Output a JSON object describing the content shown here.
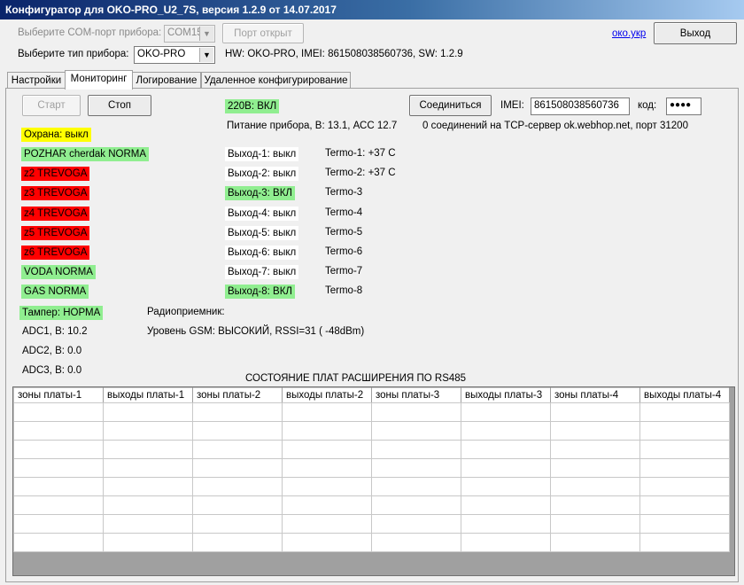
{
  "window": {
    "title": "Конфигуратор для OKO-PRO_U2_7S, версия 1.2.9 от 14.07.2017"
  },
  "top": {
    "com_label": "Выберите COM-порт прибора:",
    "com_value": "COM15",
    "port_button": "Порт открыт",
    "link": "око.укр",
    "exit_button": "Выход",
    "type_label": "Выберите тип прибора:",
    "type_value": "OKO-PRO",
    "hw_info": "HW: OKO-PRO, IMEI: 861508038560736, SW: 1.2.9"
  },
  "tabs": [
    "Настройки",
    "Мониторинг",
    "Логирование",
    "Удаленное конфигурирование"
  ],
  "monitor": {
    "start_button": "Старт",
    "stop_button": "Стоп",
    "power_status": "220В: ВКЛ",
    "power_info": "Питание прибора, В: 13.1, АСС 12.7",
    "connect_button": "Соединиться",
    "imei_label": "IMEI:",
    "imei_value": "861508038560736",
    "code_label": "код:",
    "code_value": "●●●●",
    "tcp_status": "0 соединений на TCP-сервер ok.webhop.net, порт 31200",
    "guard": "Охрана: выкл",
    "zones": [
      {
        "text": "POZHAR cherdak NORMA",
        "state": "green"
      },
      {
        "text": "z2 TREVOGA",
        "state": "red"
      },
      {
        "text": "z3 TREVOGA",
        "state": "red"
      },
      {
        "text": "z4 TREVOGA",
        "state": "red"
      },
      {
        "text": "z5 TREVOGA",
        "state": "red"
      },
      {
        "text": "z6 TREVOGA",
        "state": "red"
      },
      {
        "text": "VODA NORMA",
        "state": "green"
      },
      {
        "text": "GAS NORMA",
        "state": "green"
      }
    ],
    "outputs": [
      {
        "text": "Выход-1: выкл",
        "state": "white"
      },
      {
        "text": "Выход-2: выкл",
        "state": "white"
      },
      {
        "text": "Выход-3: ВКЛ",
        "state": "green"
      },
      {
        "text": "Выход-4: выкл",
        "state": "white"
      },
      {
        "text": "Выход-5: выкл",
        "state": "white"
      },
      {
        "text": "Выход-6: выкл",
        "state": "white"
      },
      {
        "text": "Выход-7: выкл",
        "state": "white"
      },
      {
        "text": "Выход-8: ВКЛ",
        "state": "green"
      }
    ],
    "thermo": [
      "Termo-1: +37 C",
      "Termo-2: +37 C",
      "Termo-3",
      "Termo-4",
      "Termo-5",
      "Termo-6",
      "Termo-7",
      "Termo-8"
    ],
    "tamper": "Тампер: НОРМА",
    "radio": "Радиоприемник:",
    "gsm": "Уровень GSM: ВЫСОКИЙ, RSSI=31 ( -48dBm)",
    "adc": [
      "ADC1, В: 10.2",
      "ADC2, В: 0.0",
      "ADC3, В: 0.0"
    ],
    "rs485_title": "СОСТОЯНИЕ ПЛАТ РАСШИРЕНИЯ ПО RS485",
    "grid_columns": [
      "зоны платы-1",
      "выходы платы-1",
      "зоны платы-2",
      "выходы платы-2",
      "зоны платы-3",
      "выходы платы-3",
      "зоны платы-4",
      "выходы платы-4"
    ],
    "grid_rows": [
      [
        "",
        "",
        "",
        "",
        "",
        "",
        "",
        ""
      ],
      [
        "",
        "",
        "",
        "",
        "",
        "",
        "",
        ""
      ],
      [
        "",
        "",
        "",
        "",
        "",
        "",
        "",
        ""
      ],
      [
        "",
        "",
        "",
        "",
        "",
        "",
        "",
        ""
      ],
      [
        "",
        "",
        "",
        "",
        "",
        "",
        "",
        ""
      ],
      [
        "",
        "",
        "",
        "",
        "",
        "",
        "",
        ""
      ],
      [
        "",
        "",
        "",
        "",
        "",
        "",
        "",
        ""
      ],
      [
        "",
        "",
        "",
        "",
        "",
        "",
        "",
        ""
      ]
    ]
  }
}
